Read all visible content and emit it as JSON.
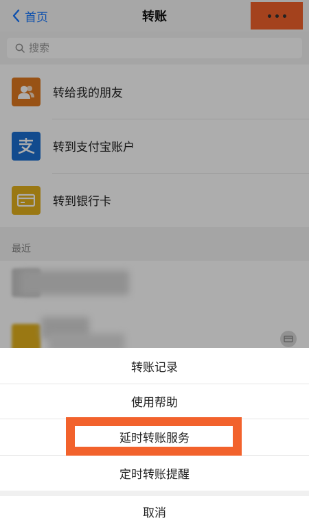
{
  "nav": {
    "back_label": "首页",
    "title": "转账",
    "more_icon": "more-dots-icon"
  },
  "search": {
    "placeholder": "搜索",
    "icon": "search-icon"
  },
  "options": [
    {
      "label": "转给我的朋友",
      "icon": "friend-icon",
      "color": "#e07a1f"
    },
    {
      "label": "转到支付宝账户",
      "icon": "alipay-icon",
      "color": "#1b6fd1"
    },
    {
      "label": "转到银行卡",
      "icon": "bank-card-icon",
      "color": "#e3b21d"
    }
  ],
  "recent": {
    "section_title": "最近"
  },
  "action_sheet": {
    "items": [
      {
        "label": "转账记录"
      },
      {
        "label": "使用帮助"
      },
      {
        "label": "延时转账服务"
      },
      {
        "label": "定时转账提醒"
      }
    ],
    "cancel_label": "取消"
  },
  "colors": {
    "accent": "#1677ff",
    "highlight": "#f2622c"
  }
}
